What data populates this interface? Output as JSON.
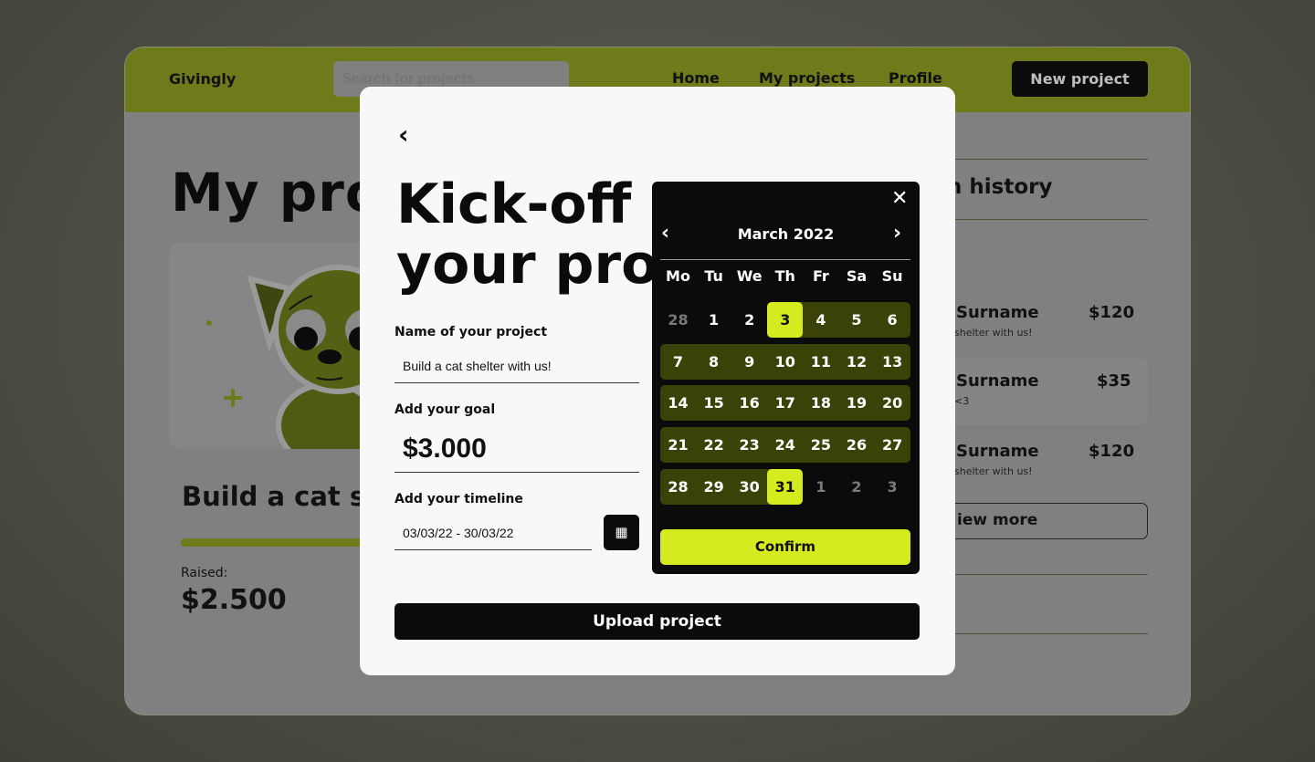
{
  "header": {
    "logo": "Givingly",
    "search_placeholder": "Search for projects",
    "nav": [
      "Home",
      "My projects",
      "Profile"
    ],
    "new_project": "New project"
  },
  "background": {
    "page_title": "My pro",
    "project_title": "Build a cat s",
    "raised_label": "Raised:",
    "raised_value": "$2.500",
    "history_title": "n history",
    "donations": [
      {
        "name": "Surname",
        "amount": "$120",
        "message": "shelter with us!"
      },
      {
        "name": "Surname",
        "amount": "$35",
        "message": "<3"
      },
      {
        "name": "Surname",
        "amount": "$120",
        "message": "shelter with us!"
      }
    ],
    "view_more": "iew more",
    "accent": "#6f7a1a"
  },
  "modal": {
    "title_line1": "Kick-off",
    "title_line2": "your proj",
    "name_label": "Name of your project",
    "name_value": "Build a cat shelter with us!",
    "goal_label": "Add your goal",
    "goal_value": "$3.000",
    "timeline_label": "Add your timeline",
    "timeline_value": "03/03/22 - 30/03/22",
    "upload": "Upload project"
  },
  "calendar": {
    "month": "March 2022",
    "weekdays": [
      "Mo",
      "Tu",
      "We",
      "Th",
      "Fr",
      "Sa",
      "Su"
    ],
    "weeks": [
      [
        "28",
        "1",
        "2",
        "3",
        "4",
        "5",
        "6"
      ],
      [
        "7",
        "8",
        "9",
        "10",
        "11",
        "12",
        "13"
      ],
      [
        "14",
        "15",
        "16",
        "17",
        "18",
        "19",
        "20"
      ],
      [
        "21",
        "22",
        "23",
        "24",
        "25",
        "26",
        "27"
      ],
      [
        "28",
        "29",
        "30",
        "31",
        "1",
        "2",
        "3"
      ]
    ],
    "range_start": "3",
    "range_end": "31",
    "confirm": "Confirm",
    "accent": "#d4ec1f",
    "range_color": "#3b4208"
  }
}
